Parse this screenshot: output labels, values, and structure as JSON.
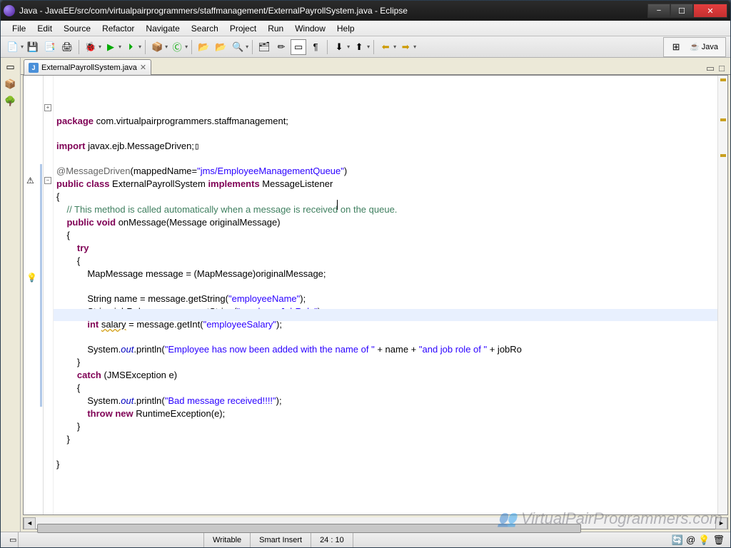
{
  "window": {
    "title": "Java - JavaEE/src/com/virtualpairprogrammers/staffmanagement/ExternalPayrollSystem.java - Eclipse"
  },
  "menu": [
    "File",
    "Edit",
    "Source",
    "Refactor",
    "Navigate",
    "Search",
    "Project",
    "Run",
    "Window",
    "Help"
  ],
  "perspective": {
    "label": "Java"
  },
  "tab": {
    "name": "ExternalPayrollSystem.java"
  },
  "status": {
    "writable": "Writable",
    "insert": "Smart Insert",
    "pos": "24 : 10"
  },
  "code": {
    "l1a": "package",
    "l1b": " com.virtualpairprogrammers.staffmanagement;",
    "l3a": "import",
    "l3b": " javax.ejb.MessageDriven;",
    "l5a": "@MessageDriven",
    "l5b": "(mappedName=",
    "l5c": "\"jms/EmployeeManagementQueue\"",
    "l5d": ")",
    "l6a": "public",
    "l6b": " class",
    "l6c": " ExternalPayrollSystem ",
    "l6d": "implements",
    "l6e": " MessageListener",
    "l7": "{",
    "l8a": "    ",
    "l8b": "// This method is called automatically when a message is received on the queue.",
    "l9a": "    ",
    "l9b": "public",
    "l9c": " void",
    "l9d": " onMessage(Message originalMessage)",
    "l10": "    {",
    "l11a": "        ",
    "l11b": "try",
    "l12": "        {",
    "l13": "            MapMessage message = (MapMessage)originalMessage;",
    "l15a": "            String name = message.getString(",
    "l15b": "\"employeeName\"",
    "l15c": ");",
    "l16a": "            String jobRole = message.getString(",
    "l16b": "\"employeeJobRole\"",
    "l16c": ");",
    "l17a": "            ",
    "l17b": "int",
    "l17c": " ",
    "l17d": "salary",
    "l17e": " = message.getInt(",
    "l17f": "\"employeeSalary\"",
    "l17g": ");",
    "l19a": "            System.",
    "l19b": "out",
    "l19c": ".println(",
    "l19d": "\"Employee has now been added with the name of \"",
    "l19e": " + name + ",
    "l19f": "\"and job role of \"",
    "l19g": " + jobRo",
    "l20": "        }",
    "l21a": "        ",
    "l21b": "catch",
    "l21c": " (JMSException e)",
    "l22": "        {",
    "l23a": "            System.",
    "l23b": "out",
    "l23c": ".println(",
    "l23d": "\"Bad message received!!!!\"",
    "l23e": ");",
    "l24a": "            ",
    "l24b": "throw",
    "l24c": " new",
    "l24d": " RuntimeException(e);",
    "l25": "        }",
    "l26": "    }",
    "l28": "}"
  },
  "watermark": "VirtualPairProgrammers.com"
}
